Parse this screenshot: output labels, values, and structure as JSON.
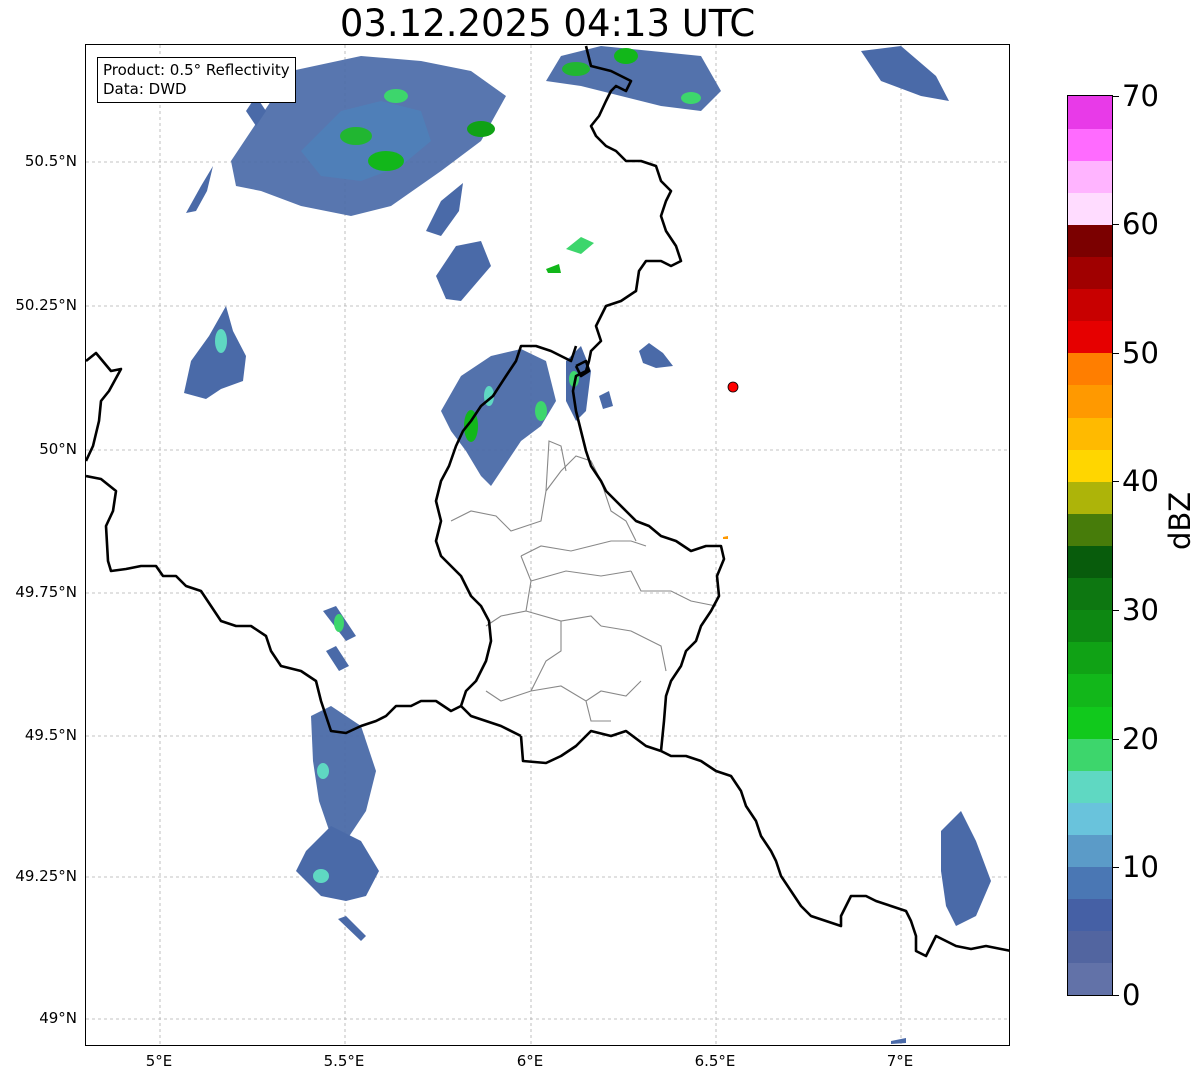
{
  "title": "03.12.2025 04:13 UTC",
  "info_box": {
    "product_line": "Product: 0.5° Reflectivity",
    "data_line": "Data: DWD"
  },
  "axes": {
    "lat_ticks": [
      "50.5°N",
      "50.25°N",
      "50°N",
      "49.75°N",
      "49.5°N",
      "49.25°N",
      "49°N"
    ],
    "lon_ticks": [
      "5°E",
      "5.5°E",
      "6°E",
      "6.5°E",
      "7°E"
    ],
    "lat_range": [
      48.95,
      50.7
    ],
    "lon_range": [
      4.8,
      7.3
    ],
    "grid": true
  },
  "colorbar": {
    "label": "dBZ",
    "ticks": [
      "0",
      "10",
      "20",
      "30",
      "40",
      "50",
      "60",
      "70"
    ],
    "range": [
      0,
      70
    ],
    "colors": [
      "#6272a8",
      "#5265a0",
      "#4560a5",
      "#4a77b4",
      "#5b9bc8",
      "#69c3dc",
      "#5fd8c2",
      "#3dd66c",
      "#11c91c",
      "#12b71a",
      "#10a215",
      "#0d8812",
      "#0d7711",
      "#085c0c",
      "#477c0a",
      "#adb409",
      "#ffd600",
      "#ffba00",
      "#ff9900",
      "#ff7e00",
      "#e60000",
      "#c80000",
      "#a00000",
      "#7b0000",
      "#ffdcff",
      "#ffb4ff",
      "#ff6bff",
      "#e83ae8"
    ]
  },
  "marker": {
    "color": "#ff0000",
    "lat": 50.11,
    "lon": 6.55
  },
  "colors": {
    "border": "#000000",
    "internal_border": "#888888",
    "grid": "#b0b0b0"
  }
}
